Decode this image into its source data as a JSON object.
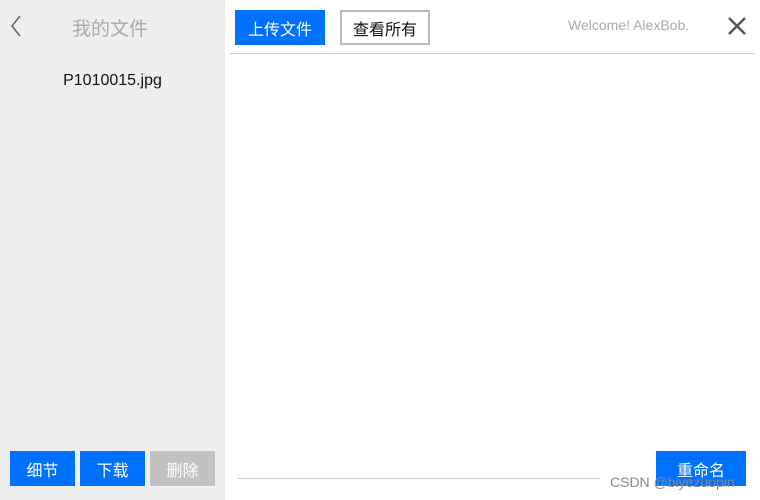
{
  "sidebar": {
    "title": "我的文件",
    "files": [
      "P1010015.jpg"
    ],
    "buttons": {
      "details": "细节",
      "download": "下载",
      "delete": "删除"
    }
  },
  "header": {
    "upload": "上传文件",
    "view_all": "查看所有",
    "welcome": "Welcome! AlexBob."
  },
  "footer": {
    "rename": "重命名"
  },
  "watermark": "CSDN @biyezuopin"
}
